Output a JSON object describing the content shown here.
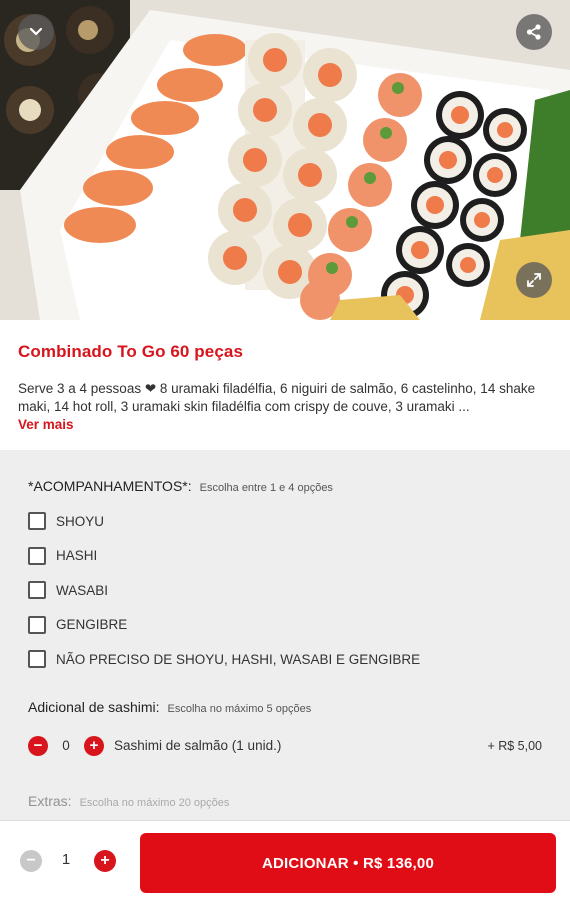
{
  "product": {
    "title": "Combinado To Go 60 peças",
    "description": "Serve 3 a 4 pessoas ❤ 8 uramaki filadélfia, 6 niguiri de salmão, 6 castelinho, 14 shake maki, 14 hot roll, 3 uramaki skin filadélfia com crispy de couve, 3 uramaki ...",
    "more_label": "Ver mais"
  },
  "hero": {
    "back_icon": "chevron-down-icon",
    "share_icon": "share-icon",
    "expand_icon": "expand-icon"
  },
  "accompaniments": {
    "title": "*ACOMPANHAMENTOS*:",
    "hint": "Escolha entre 1 e 4 opções",
    "options": [
      "SHOYU",
      "HASHI",
      "WASABI",
      "GENGIBRE",
      "NÃO PRECISO DE SHOYU, HASHI, WASABI E GENGIBRE"
    ]
  },
  "sashimi": {
    "title": "Adicional de sashimi:",
    "hint": "Escolha no máximo 5 opções",
    "items": [
      {
        "name": "Sashimi de salmão (1 unid.)",
        "qty": "0",
        "price": "+ R$ 5,00"
      }
    ]
  },
  "extras": {
    "title": "Extras:",
    "hint": "Escolha no máximo 20 opções"
  },
  "footer": {
    "qty": "1",
    "add_label": "ADICIONAR • R$ 136,00"
  },
  "colors": {
    "accent": "#d8141c",
    "panel_bg": "#eeeeee"
  }
}
